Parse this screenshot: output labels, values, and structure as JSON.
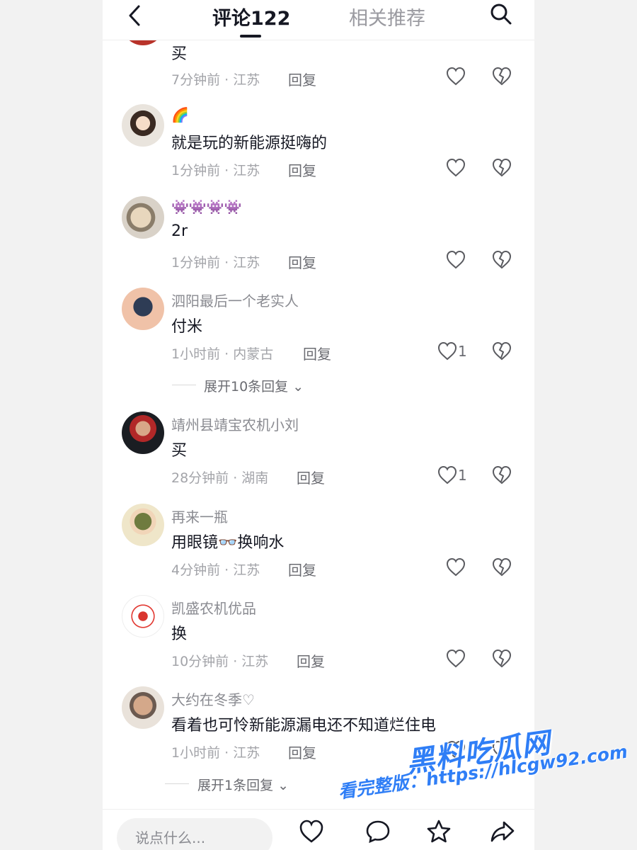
{
  "header": {
    "tab_comments": "评论122",
    "tab_related": "相关推荐",
    "back_icon": "chevron-left-icon",
    "search_icon": "search-icon"
  },
  "comments": [
    {
      "username": "",
      "text": "买",
      "time": "7分钟前 · 江苏",
      "reply": "回复",
      "likes": ""
    },
    {
      "username": "🌈",
      "text": "就是玩的新能源挺嗨的",
      "time": "1分钟前 · 江苏",
      "reply": "回复",
      "likes": ""
    },
    {
      "username": "👾👾👾👾",
      "text": "2r",
      "time": "1分钟前 · 江苏",
      "reply": "回复",
      "likes": ""
    },
    {
      "username": "泗阳最后一个老实人",
      "text": "付米",
      "time": "1小时前 · 内蒙古",
      "reply": "回复",
      "likes": "1",
      "expand": "展开10条回复"
    },
    {
      "username": "靖州县靖宝农机小刘",
      "text": "买",
      "time": "28分钟前 · 湖南",
      "reply": "回复",
      "likes": "1"
    },
    {
      "username": "再来一瓶",
      "text": "用眼镜👓换响水",
      "time": "4分钟前 · 江苏",
      "reply": "回复",
      "likes": ""
    },
    {
      "username": "凯盛农机优品",
      "text": "换",
      "time": "10分钟前 · 江苏",
      "reply": "回复",
      "likes": ""
    },
    {
      "username": "大约在冬季♡",
      "text": "看着也可怜新能源漏电还不知道烂住电",
      "time": "1小时前 · 江苏",
      "reply": "回复",
      "likes": "",
      "expand": "展开1条回复"
    }
  ],
  "input": {
    "placeholder": "说点什么..."
  },
  "bottom_icons": [
    "heart-icon",
    "comment-icon",
    "star-icon",
    "share-icon"
  ],
  "watermark": {
    "line1": "黑料吃瓜网",
    "line2": "看完整版：https://hlcgw92.com"
  },
  "colors": {
    "text": "#161823",
    "muted": "#a3a4a9",
    "watermark": "#2f7ef6"
  }
}
